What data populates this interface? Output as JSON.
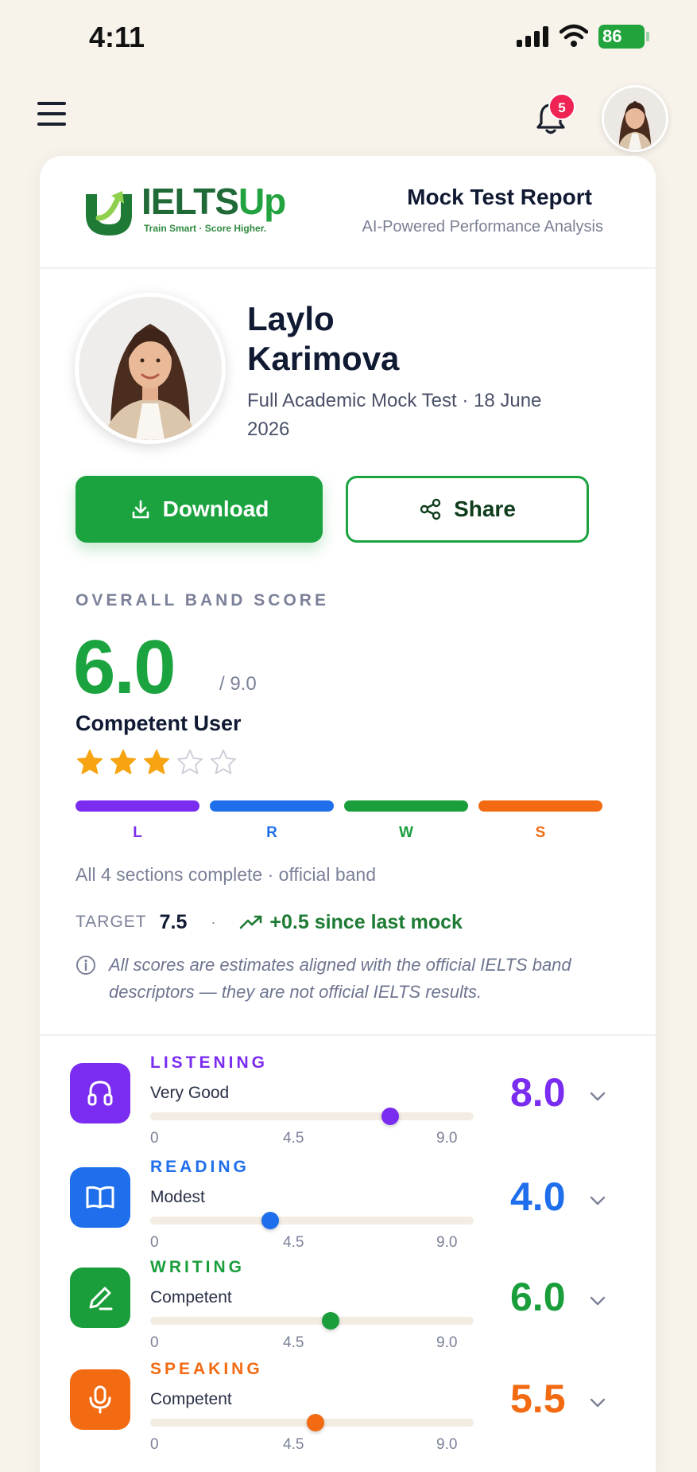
{
  "status": {
    "time": "4:11",
    "battery": "86"
  },
  "nav": {
    "notifications": "5"
  },
  "brand": {
    "name_part1": "IELTS",
    "name_part2": "Up",
    "tagline": "Train Smart · Score Higher."
  },
  "report": {
    "title": "Mock Test Report",
    "subtitle": "AI-Powered Performance Analysis"
  },
  "candidate": {
    "name": "Laylo Karimova",
    "exam": "Full Academic Mock Test · 18 June 2026"
  },
  "actions": {
    "download": "Download",
    "share": "Share"
  },
  "overall": {
    "label": "OVERALL BAND SCORE",
    "score": "6.0",
    "max": "/ 9.0",
    "level": "Competent User",
    "stars_filled": 3,
    "stars_total": 5,
    "segments": [
      {
        "label": "L",
        "color": "#7a2cf0"
      },
      {
        "label": "R",
        "color": "#1f6fec"
      },
      {
        "label": "W",
        "color": "#1a9e3b"
      },
      {
        "label": "S",
        "color": "#f26a11"
      }
    ],
    "sections_note": "All 4 sections complete · official band",
    "target_label": "TARGET",
    "target_value": "7.5",
    "separator": "·",
    "trend": "+0.5 since last mock",
    "disclaimer": "All scores are estimates aligned with the official IELTS band descriptors — they are not official IELTS results."
  },
  "skills": [
    {
      "name": "LISTENING",
      "level": "Very Good",
      "score": "8.0",
      "value": 8.0,
      "color": "#7a2cf0",
      "icon": "headphones-icon"
    },
    {
      "name": "READING",
      "level": "Modest",
      "score": "4.0",
      "value": 4.0,
      "color": "#1f6fec",
      "icon": "book-icon"
    },
    {
      "name": "WRITING",
      "level": "Competent",
      "score": "6.0",
      "value": 6.0,
      "color": "#1a9e3b",
      "icon": "pen-icon"
    },
    {
      "name": "SPEAKING",
      "level": "Competent",
      "score": "5.5",
      "value": 5.5,
      "color": "#f26a11",
      "icon": "microphone-icon"
    }
  ],
  "scale": {
    "min": "0",
    "mid": "4.5",
    "max": "9.0"
  }
}
